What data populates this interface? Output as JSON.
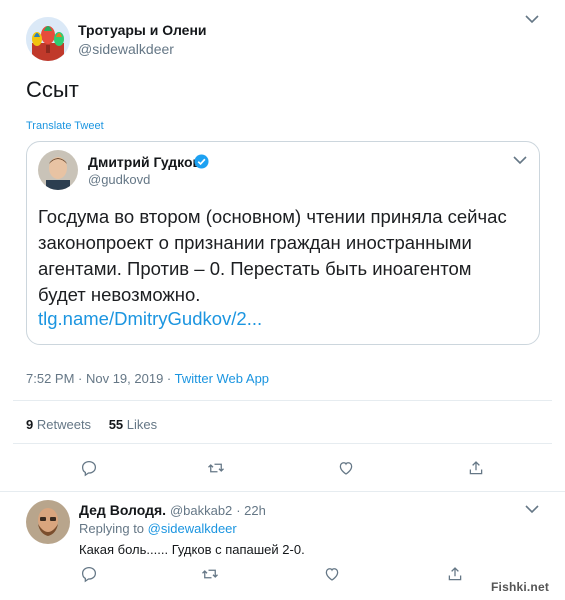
{
  "tweet": {
    "author_name": "Тротуары и Олени",
    "author_handle": "@sidewalkdeer",
    "text": "Ссыт",
    "translate_label": "Translate Tweet",
    "timestamp": "7:52 PM · Nov 19, 2019 · ",
    "source": "Twitter Web App",
    "retweets_count": "9",
    "retweets_label": "Retweets",
    "likes_count": "55",
    "likes_label": "Likes"
  },
  "quoted": {
    "author_name": "Дмитрий Гудков",
    "author_handle": "@gudkovd",
    "text": "Госдума во втором (основном) чтении приняла сейчас законопроект о признании граждан иностранными агентами. Против – 0. Перестать быть иноагентом будет невозможно.",
    "link": "tlg.name/DmitryGudkov/2..."
  },
  "reply": {
    "author_name": "Дед Володя.",
    "author_handle": "@bakkab2",
    "time": "· 22h",
    "replying_prefix": "Replying to ",
    "replying_handle": "@sidewalkdeer",
    "text": "Какая боль...... Гудков с папашей 2-0."
  },
  "watermark": "Fishki.net",
  "colors": {
    "link": "#1b95e0",
    "muted": "#657786",
    "verified": "#1da1f2",
    "divider": "#e6ecf0"
  }
}
